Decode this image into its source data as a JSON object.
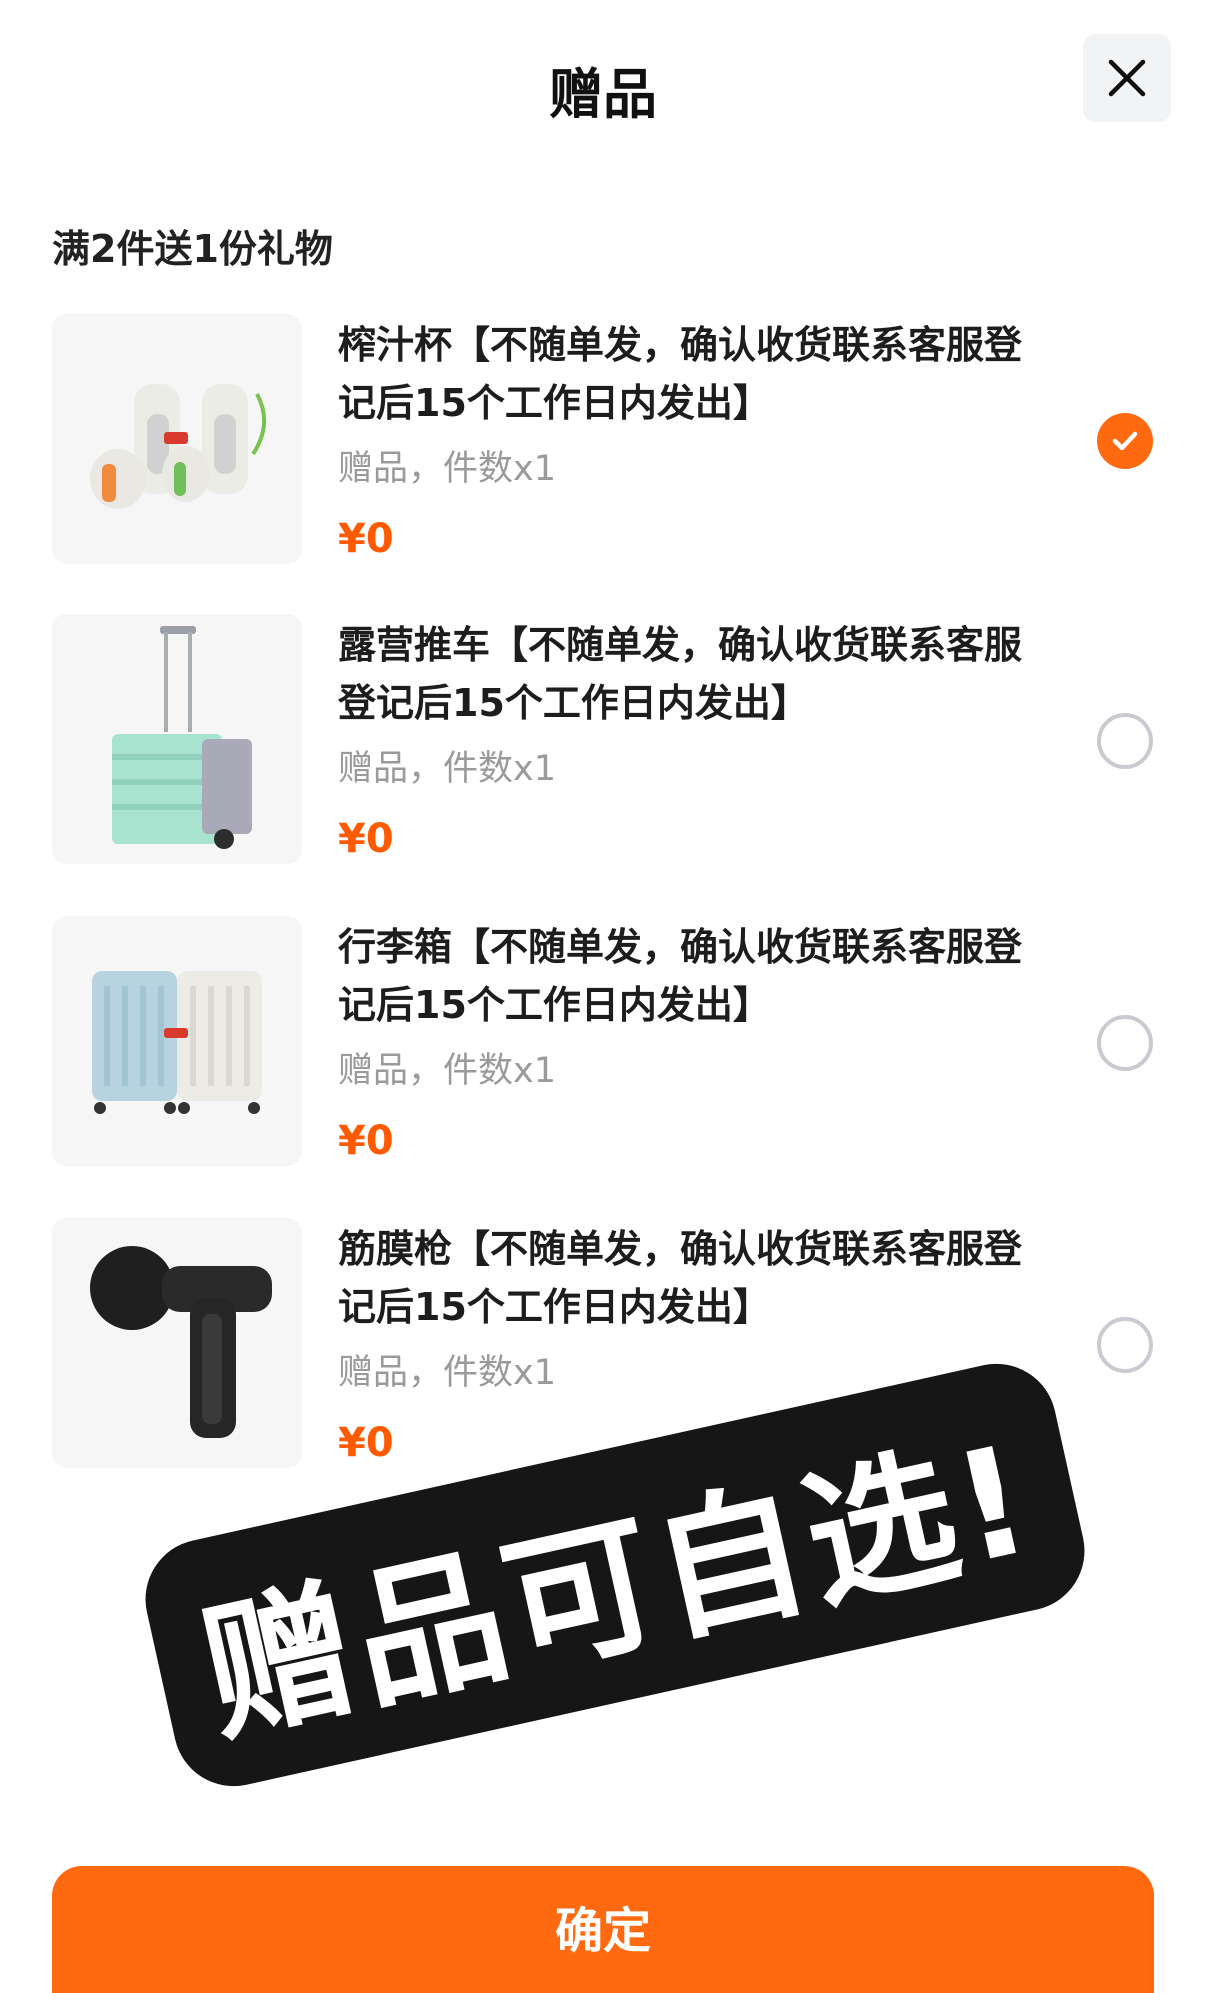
{
  "header": {
    "title": "赠品",
    "close_icon": "close-icon"
  },
  "promo": {
    "subtitle": "满2件送1份礼物"
  },
  "gifts": [
    {
      "name": "榨汁杯【不随单发，确认收货联系客服登记后15个工作日内发出】",
      "meta": "赠品，件数x1",
      "price": "¥0",
      "selected": true,
      "icon": "juicer-cup-image"
    },
    {
      "name": "露营推车【不随单发，确认收货联系客服登记后15个工作日内发出】",
      "meta": "赠品，件数x1",
      "price": "¥0",
      "selected": false,
      "icon": "camping-cart-image"
    },
    {
      "name": "行李箱【不随单发，确认收货联系客服登记后15个工作日内发出】",
      "meta": "赠品，件数x1",
      "price": "¥0",
      "selected": false,
      "icon": "suitcase-image"
    },
    {
      "name": "筋膜枪【不随单发，确认收货联系客服登记后15个工作日内发出】",
      "meta": "赠品，件数x1",
      "price": "¥0",
      "selected": false,
      "icon": "massage-gun-image"
    }
  ],
  "overlay": {
    "text": "赠品可自选!"
  },
  "footer": {
    "confirm_label": "确定"
  },
  "colors": {
    "accent": "#ff6a10",
    "price": "#ff5a00",
    "banner": "#161616"
  }
}
